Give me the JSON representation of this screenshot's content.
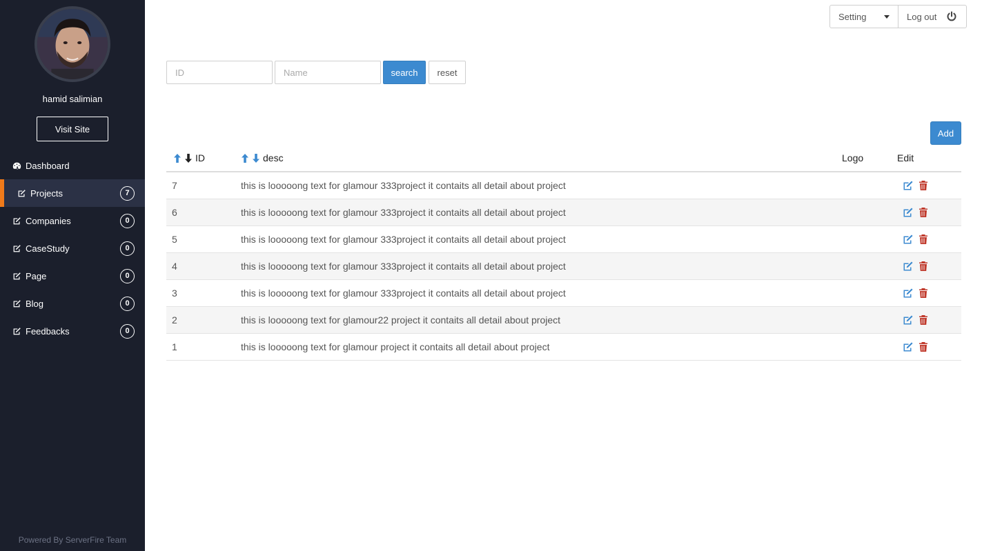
{
  "sidebar": {
    "username": "hamid salimian",
    "visit_site": "Visit Site",
    "items": [
      {
        "label": "Dashboard",
        "icon": "dashboard-icon",
        "badge": ""
      },
      {
        "label": "Projects",
        "icon": "edit-icon",
        "badge": "7"
      },
      {
        "label": "Companies",
        "icon": "edit-icon",
        "badge": "0"
      },
      {
        "label": "CaseStudy",
        "icon": "edit-icon",
        "badge": "0"
      },
      {
        "label": "Page",
        "icon": "edit-icon",
        "badge": "0"
      },
      {
        "label": "Blog",
        "icon": "edit-icon",
        "badge": "0"
      },
      {
        "label": "Feedbacks",
        "icon": "edit-icon",
        "badge": "0"
      }
    ],
    "active_index": 1,
    "footer": "Powered By ServerFire Team"
  },
  "topbar": {
    "setting": "Setting",
    "logout": "Log out"
  },
  "search": {
    "id_placeholder": "ID",
    "name_placeholder": "Name",
    "search_label": "search",
    "reset_label": "reset"
  },
  "add_label": "Add",
  "table": {
    "headers": {
      "id": "ID",
      "desc": "desc",
      "logo": "Logo",
      "edit": "Edit"
    },
    "rows": [
      {
        "id": "7",
        "desc": "this is looooong text for glamour 333project it contaits all detail about project"
      },
      {
        "id": "6",
        "desc": "this is looooong text for glamour 333project it contaits all detail about project"
      },
      {
        "id": "5",
        "desc": "this is looooong text for glamour 333project it contaits all detail about project"
      },
      {
        "id": "4",
        "desc": "this is looooong text for glamour 333project it contaits all detail about project"
      },
      {
        "id": "3",
        "desc": "this is looooong text for glamour 333project it contaits all detail about project"
      },
      {
        "id": "2",
        "desc": "this is looooong text for glamour22 project it contaits all detail about project"
      },
      {
        "id": "1",
        "desc": "this is looooong text for glamour project it contaits all detail about project"
      }
    ]
  },
  "colors": {
    "sidebar_bg": "#1b1f2c",
    "accent": "#f07a1a",
    "primary": "#3c8ad0",
    "delete": "#c0392b"
  }
}
